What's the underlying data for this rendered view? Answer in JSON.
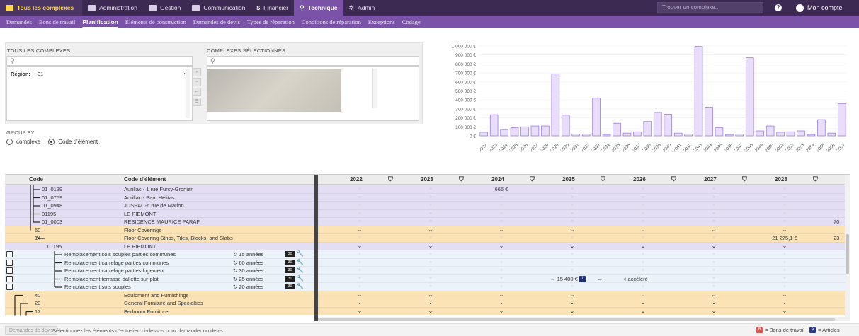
{
  "topnav": {
    "brand": "Tous les complexes",
    "items": [
      "Administration",
      "Gestion",
      "Communication",
      "Financier",
      "Technique",
      "Admin"
    ],
    "active": "Technique",
    "search_placeholder": "Trouver un complexe...",
    "help": "?",
    "account": "Mon compte"
  },
  "subnav": {
    "items": [
      "Demandes",
      "Bons de travail",
      "Planification",
      "Éléments de construction",
      "Demandes de devis",
      "Types de réparation",
      "Conditions de réparation",
      "Exceptions",
      "Codage"
    ],
    "active": "Planification"
  },
  "selector": {
    "all_label": "TOUS LES COMPLEXES",
    "selected_label": "COMPLEXES SÉLECTIONNÉS",
    "region_label": "Région:",
    "region_value": "01"
  },
  "group_by": {
    "label": "GROUP BY",
    "options": [
      "complexe",
      "Code d'élément"
    ],
    "selected": "Code d'élément"
  },
  "chart_data": {
    "type": "bar",
    "y_ticks": [
      "1 000 000 €",
      "900 000 €",
      "800 000 €",
      "700 000 €",
      "600 000 €",
      "500 000 €",
      "400 000 €",
      "300 000 €",
      "200 000 €",
      "100 000 €",
      "0 €"
    ],
    "ylim": [
      0,
      1000000
    ],
    "categories": [
      "2022",
      "2023",
      "2024",
      "2025",
      "2026",
      "2027",
      "2028",
      "2029",
      "2030",
      "2031",
      "2032",
      "2033",
      "2034",
      "2035",
      "2036",
      "2037",
      "2038",
      "2039",
      "2040",
      "2041",
      "2042",
      "2043",
      "2044",
      "2045",
      "2046",
      "2047",
      "2048",
      "2049",
      "2050",
      "2051",
      "2052",
      "2053",
      "2054",
      "2055",
      "2056",
      "2057"
    ],
    "values": [
      40000,
      235000,
      70000,
      90000,
      100000,
      110000,
      110000,
      690000,
      230000,
      20000,
      20000,
      420000,
      15000,
      140000,
      30000,
      45000,
      160000,
      260000,
      240000,
      30000,
      20000,
      995000,
      320000,
      90000,
      15000,
      20000,
      870000,
      55000,
      110000,
      40000,
      45000,
      55000,
      15000,
      180000,
      30000,
      360000
    ],
    "colors": {
      "fill": "#e9ddfc",
      "stroke": "#9c7ee0"
    }
  },
  "table": {
    "headers": {
      "code": "Code",
      "element": "Code d'élément"
    },
    "years": [
      "2022",
      "2023",
      "2024",
      "2025",
      "2026",
      "2027",
      "2028"
    ],
    "rows": [
      {
        "type": "complex",
        "code": "01_0139",
        "name": "Aurillac - 1 rue Furcy-Gronier",
        "cells": [
          "dot",
          "dot",
          "665 €",
          "dot",
          "dot",
          "dot",
          "dot"
        ]
      },
      {
        "type": "complex",
        "code": "01_0759",
        "name": "Aurillac - Parc Hélitas",
        "cells": [
          "dot",
          "dot",
          "dot",
          "dot",
          "dot",
          "dot",
          "dot"
        ]
      },
      {
        "type": "complex",
        "code": "01_0948",
        "name": "JUSSAC-6 rue de Marion",
        "cells": [
          "dot",
          "dot",
          "dot",
          "dot",
          "dot",
          "dot",
          "dot"
        ]
      },
      {
        "type": "complex",
        "code": "01195",
        "name": "LE PIEMONT",
        "cells": [
          "dot",
          "dot",
          "dot",
          "dot",
          "dot",
          "dot",
          "dot"
        ]
      },
      {
        "type": "complex",
        "code": "01_0003",
        "name": "RESIDENCE MAURICE PARAF",
        "cells": [
          "dot",
          "dot",
          "dot",
          "dot",
          "dot",
          "dot",
          "dot"
        ],
        "edge": "70"
      },
      {
        "type": "group",
        "code": "50",
        "name": "Floor Coverings",
        "cells": [
          "chev",
          "chev",
          "chev",
          "chev",
          "chev",
          "chev",
          "chev"
        ]
      },
      {
        "type": "group",
        "code": "14",
        "name": "Floor Covering Strips, Tiles, Blocks, and Slabs",
        "cells": [
          "dot",
          "dot",
          "dot",
          "dot",
          "dot",
          "dot",
          "21 275,1 €"
        ],
        "edge": "23"
      },
      {
        "type": "complex2",
        "code": "01195",
        "name": "LE PIEMONT",
        "cells": [
          "chev",
          "chev",
          "chev",
          "chev",
          "chev",
          "chev",
          "chev"
        ]
      },
      {
        "type": "task",
        "name": "Remplacement sols souples parties communes",
        "dur": "↻ 15 années",
        "badge": "30",
        "cells": [
          "dot",
          "dot",
          "dot",
          "dot",
          "dot",
          "dot",
          "dot"
        ]
      },
      {
        "type": "task",
        "name": "Remplacement carrelage parties communes",
        "dur": "↻ 60 années",
        "badge": "30",
        "cells": [
          "dot",
          "dot",
          "dot",
          "dot",
          "dot",
          "dot",
          "dot"
        ]
      },
      {
        "type": "task",
        "name": "Remplacement carrelage parties logement",
        "dur": "↻ 30 années",
        "badge": "30",
        "cells": [
          "dot",
          "dot",
          "dot",
          "dot",
          "dot",
          "dot",
          "dot"
        ]
      },
      {
        "type": "task",
        "name": "Remplacement terrasse dallette sur plot",
        "dur": "↻ 25 années",
        "badge": "30",
        "cells": [
          "dot",
          "dot",
          "dot",
          "special",
          "special",
          "dot",
          "dot"
        ]
      },
      {
        "type": "task",
        "name": "Remplacement sols souples",
        "dur": "↻ 20 années",
        "badge": "30",
        "cells": [
          "dot",
          "dot",
          "dot",
          "dot",
          "dot",
          "dot",
          "dot"
        ]
      },
      {
        "type": "group",
        "code": "40",
        "name": "Equipment and Furnishings",
        "cells": [
          "chev",
          "chev",
          "chev",
          "chev",
          "chev",
          "chev",
          "chev"
        ]
      },
      {
        "type": "group",
        "code": "20",
        "name": "General Furniture and Specialties",
        "cells": [
          "chev",
          "chev",
          "chev",
          "chev",
          "chev",
          "chev",
          "chev"
        ]
      },
      {
        "type": "group",
        "code": "17",
        "name": "Bedroom Furniture",
        "cells": [
          "chev",
          "chev",
          "chev",
          "chev",
          "chev",
          "chev",
          "chev"
        ]
      }
    ],
    "special": {
      "price": "← 15 400 €",
      "badge": "1",
      "arrow": "→",
      "accel": "< accéléré"
    }
  },
  "footer": {
    "button": "Demandes de devis",
    "message": "Sélectionnez les éléments d'entretien ci-dessus pour demander un devis",
    "legend_bt_text": "= Bons de travail",
    "legend_art_text": "= Articles",
    "legend_bt_symbol": "B",
    "legend_art_symbol": "A",
    "colors": {
      "bons": "#d9534f",
      "articles": "#2a3a8a"
    }
  }
}
